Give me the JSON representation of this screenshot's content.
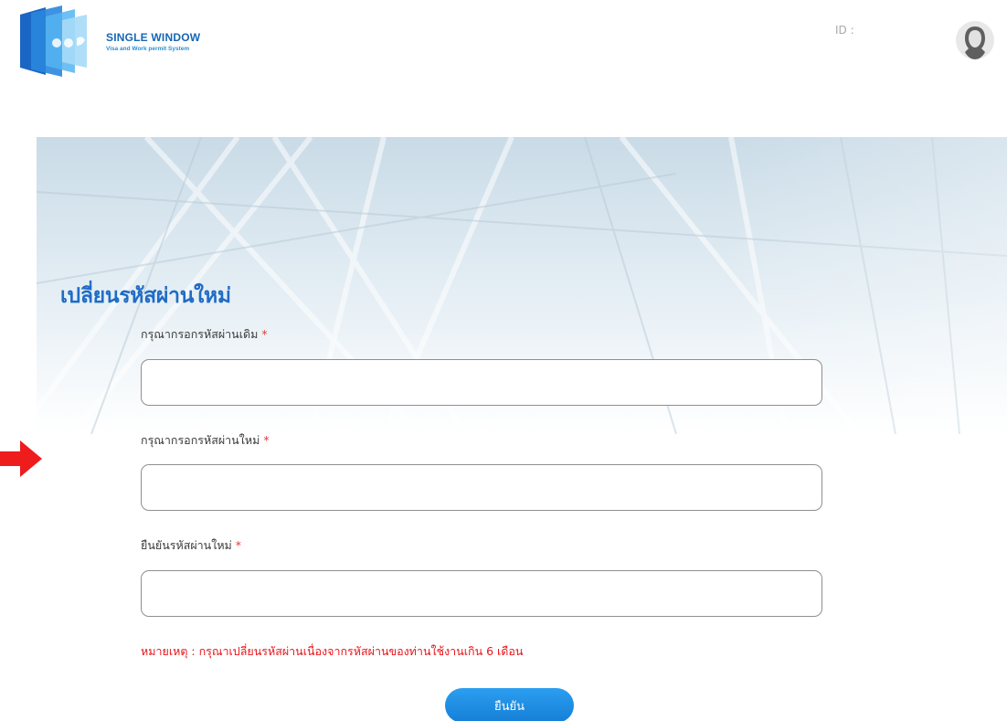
{
  "header": {
    "logo": {
      "title": "SINGLE WINDOW",
      "subtitle": "Visa and Work permit System",
      "icon": "single-window-logo"
    },
    "user_id_label": "ID :",
    "avatar_icon": "user-avatar-icon"
  },
  "form": {
    "title": "เปลี่ยนรหัสผ่านใหม่",
    "fields": [
      {
        "label": "กรุณากรอกรหัสผ่านเดิม",
        "required_mark": "*",
        "value": "",
        "placeholder": ""
      },
      {
        "label": "กรุณากรอกรหัสผ่านใหม่",
        "required_mark": "*",
        "value": "",
        "placeholder": ""
      },
      {
        "label": "ยืนยันรหัสผ่านใหม่",
        "required_mark": "*",
        "value": "",
        "placeholder": ""
      }
    ],
    "note": "หมายเหตุ : กรุณาเปลี่ยนรหัสผ่านเนื่องจากรหัสผ่านของท่านใช้งานเกิน 6 เดือน",
    "confirm_label": "ยืนยัน"
  },
  "annotation": {
    "arrow_icon": "red-arrow-right-icon",
    "arrow_color": "#ee1c1c"
  },
  "colors": {
    "brand_blue": "#1f6cc6",
    "button_blue": "#1a8ee6",
    "required_red": "#e53935",
    "note_red": "#e8141b"
  }
}
